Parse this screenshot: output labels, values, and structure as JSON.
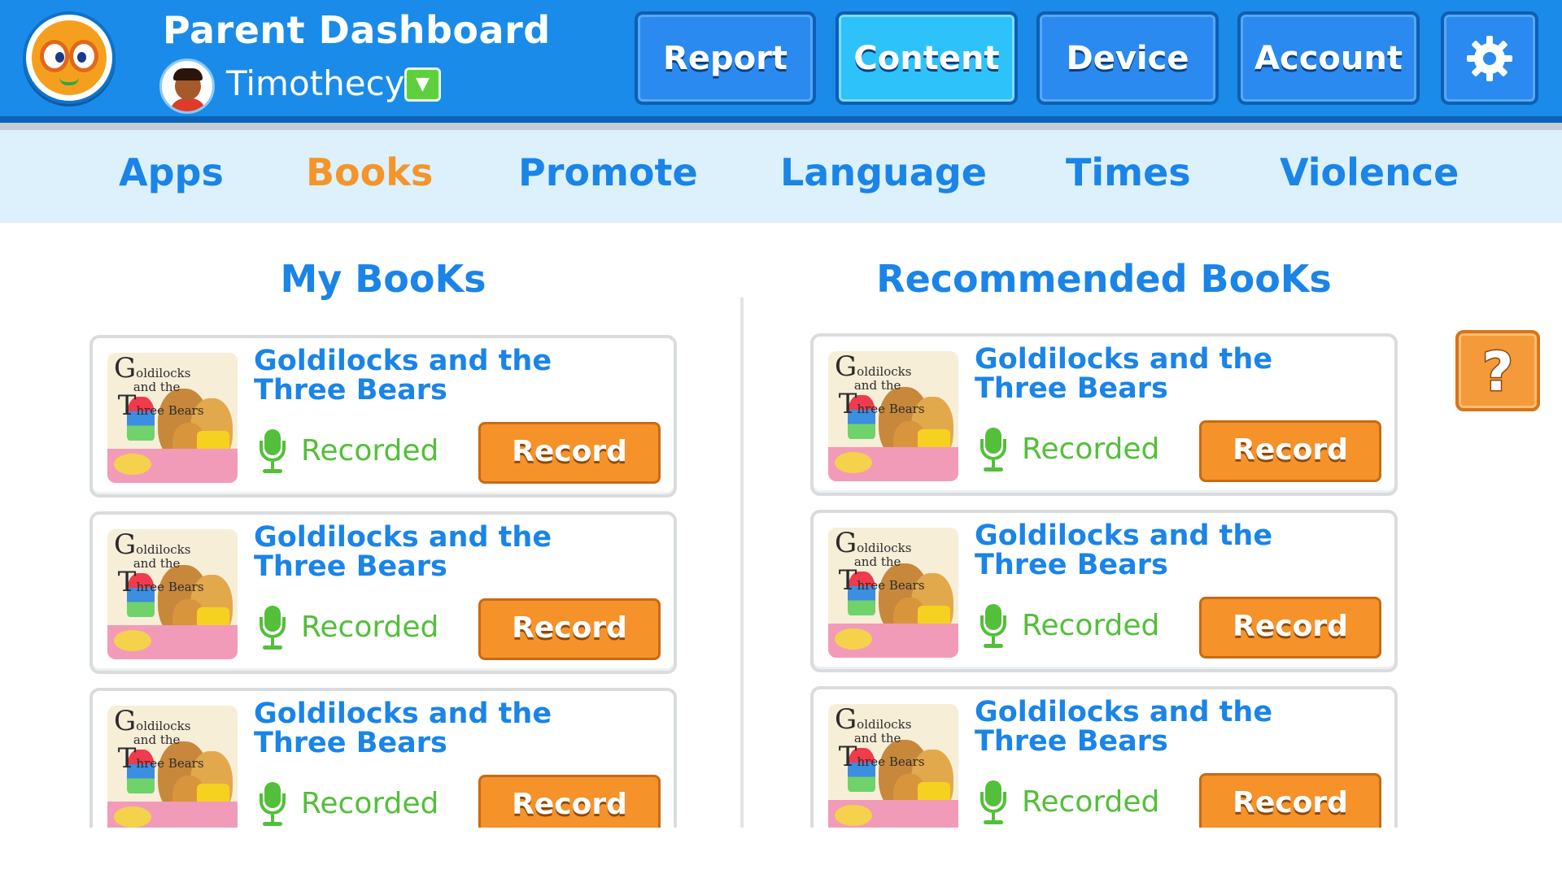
{
  "header": {
    "title": "Parent Dashboard",
    "user": {
      "name": "Timothecy"
    },
    "nav": [
      {
        "label": "Report",
        "active": false
      },
      {
        "label": "Content",
        "active": true
      },
      {
        "label": "Device",
        "active": false
      },
      {
        "label": "Account",
        "active": false
      }
    ],
    "settings_icon": "gear-icon"
  },
  "tabs": [
    {
      "label": "Apps",
      "active": false
    },
    {
      "label": "Books",
      "active": true
    },
    {
      "label": "Promote",
      "active": false
    },
    {
      "label": "Language",
      "active": false
    },
    {
      "label": "Times",
      "active": false
    },
    {
      "label": "Violence",
      "active": false
    }
  ],
  "my_books": {
    "title": "My BooKs",
    "items": [
      {
        "title": "Goldilocks and the Three Bears",
        "status": "Recorded",
        "action": "Record"
      },
      {
        "title": "Goldilocks and the Three Bears",
        "status": "Recorded",
        "action": "Record"
      },
      {
        "title": "Goldilocks and the Three Bears",
        "status": "Recorded",
        "action": "Record"
      }
    ]
  },
  "recommended_books": {
    "title": "Recommended BooKs",
    "items": [
      {
        "title": "Goldilocks and the Three Bears",
        "status": "Recorded",
        "action": "Record"
      },
      {
        "title": "Goldilocks and the Three Bears",
        "status": "Recorded",
        "action": "Record"
      },
      {
        "title": "Goldilocks and the Three Bears",
        "status": "Recorded",
        "action": "Record"
      }
    ]
  },
  "cover": {
    "line1": "G",
    "line1_rest": "oldilocks",
    "line2": "and the",
    "line3": "T",
    "line3_rest": "hree Bears"
  },
  "help": {
    "label": "?",
    "icon": "question-icon"
  },
  "colors": {
    "header_blue": "#1a8be8",
    "accent_orange": "#f5922a",
    "recorded_green": "#53bf3a",
    "tab_bg": "#dcf1fc"
  }
}
